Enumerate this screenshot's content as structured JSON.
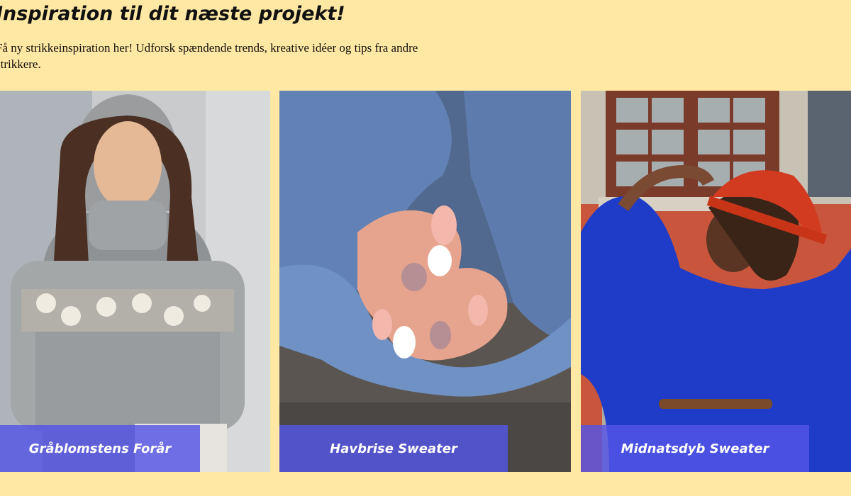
{
  "header": {
    "title": "Inspiration til dit næste projekt!",
    "intro": "Få ny strikkeinspiration her! Udforsk spændende trends, kreative idéer og tips fra andre strikkere."
  },
  "gallery": {
    "cards": [
      {
        "caption": "Gråblomstens Forår",
        "image": "woman-grey-flower-sweater-photo"
      },
      {
        "caption": "Havbrise Sweater",
        "image": "hands-blue-mohair-sleeves-photo"
      },
      {
        "caption": "Midnatsdyb Sweater",
        "image": "woman-cobalt-sweater-red-hat-photo"
      }
    ]
  },
  "colors": {
    "background": "#FFE8A3",
    "caption_overlay": "#5454E6"
  }
}
